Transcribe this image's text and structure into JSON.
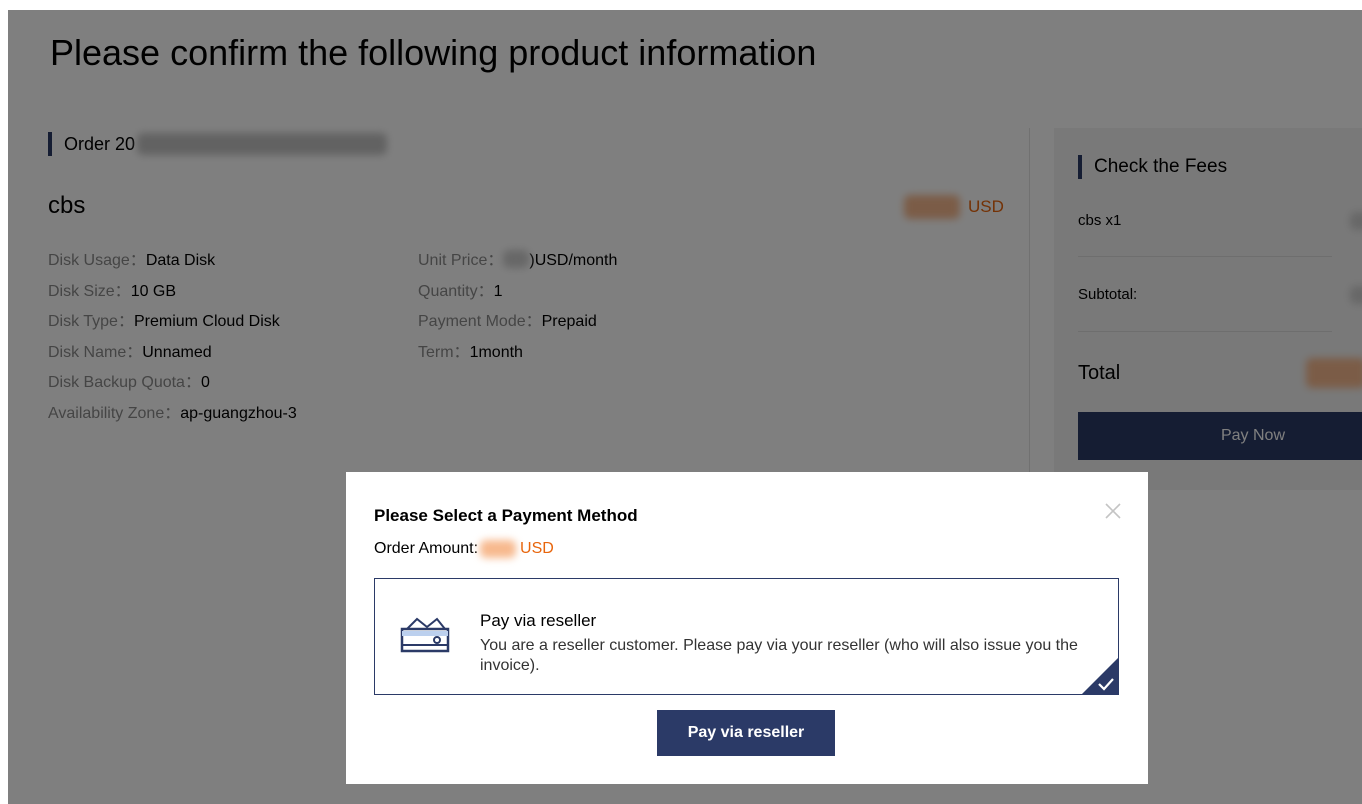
{
  "page": {
    "title": "Please confirm the following product information"
  },
  "order": {
    "label": "Order 20",
    "product_name": "cbs",
    "price_unit": "USD",
    "specs_left": [
      {
        "label": "Disk Usage：",
        "value": "Data Disk"
      },
      {
        "label": "Disk Size：",
        "value": "10 GB"
      },
      {
        "label": "Disk Type：",
        "value": "Premium Cloud Disk"
      },
      {
        "label": "Disk Name：",
        "value": "Unnamed"
      },
      {
        "label": "Disk Backup Quota：",
        "value": "0"
      },
      {
        "label": "Availability Zone：",
        "value": "ap-guangzhou-3"
      }
    ],
    "specs_right": [
      {
        "label": "Unit Price：",
        "value": ")USD/month"
      },
      {
        "label": "Quantity：",
        "value": "1"
      },
      {
        "label": "Payment Mode：",
        "value": "Prepaid"
      },
      {
        "label": "Term：",
        "value": "1month"
      }
    ]
  },
  "fees": {
    "title": "Check the Fees",
    "item": "cbs x1",
    "subtotal_label": "Subtotal:",
    "total_label": "Total",
    "pay_now_label": "Pay Now"
  },
  "modal": {
    "title": "Please Select a Payment Method",
    "order_amount_label": "Order Amount:",
    "amount_unit": "USD",
    "method": {
      "name": "Pay via reseller",
      "description": "You are a reseller customer. Please pay via your reseller (who will also issue you the invoice).",
      "selected": true
    },
    "confirm_label": "Pay via reseller"
  },
  "colors": {
    "accent": "#2b3a67",
    "price": "#e8650c",
    "muted_text": "#8a8a8a"
  },
  "icons": [
    "close-icon",
    "wallet-icon",
    "checkmark-icon"
  ]
}
